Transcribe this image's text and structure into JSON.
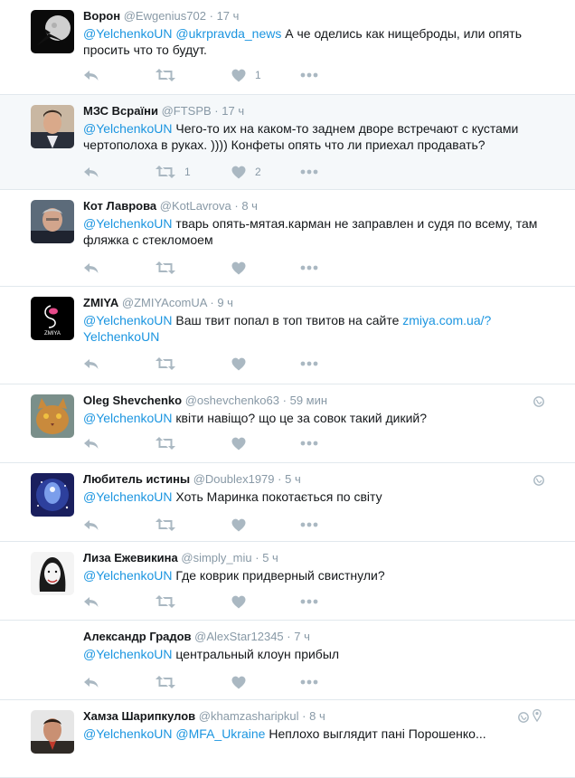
{
  "colors": {
    "link": "#1b95e0",
    "meta": "#8899a6",
    "action_icon": "#aab8c2",
    "highlight_bg": "#f5f8fa",
    "border": "#e1e8ed"
  },
  "tweets": [
    {
      "name": "Ворон",
      "handle": "@Ewgenius702",
      "sep": "·",
      "time": "17 ч",
      "segments": [
        {
          "text": "@YelchenkoUN",
          "link": true
        },
        {
          "text": " ",
          "link": false
        },
        {
          "text": "@ukrpravda_news",
          "link": true
        },
        {
          "text": " А че оделись как нищеброды, или опять просить что то будут.",
          "link": false
        }
      ],
      "retweets": "",
      "likes": "1",
      "avatar": "moon-avatar"
    },
    {
      "name": "МЗС Всраїни",
      "handle": "@FTSPB",
      "sep": "·",
      "time": "17 ч",
      "segments": [
        {
          "text": "@YelchenkoUN",
          "link": true
        },
        {
          "text": " Чего-то их на каком-то заднем дворе встречают с кустами чертополоха в руках. )))) Конфеты опять что ли приехал продавать?",
          "link": false
        }
      ],
      "retweets": "1",
      "likes": "2",
      "avatar": "man-suit-avatar"
    },
    {
      "name": "Кот Лаврова",
      "handle": "@KotLavrova",
      "sep": "·",
      "time": "8 ч",
      "segments": [
        {
          "text": "@YelchenkoUN",
          "link": true
        },
        {
          "text": " тварь опять-мятая.карман не заправлен и судя по всему, там фляжка с стекломоем",
          "link": false
        }
      ],
      "retweets": "",
      "likes": "",
      "avatar": "man-grey-avatar"
    },
    {
      "name": "ZMIYA",
      "handle": "@ZMIYAcomUA",
      "sep": "·",
      "time": "9 ч",
      "segments": [
        {
          "text": "@YelchenkoUN",
          "link": true
        },
        {
          "text": " Ваш твит попал в топ твитов на сайте ",
          "link": false
        },
        {
          "text": "zmiya.com.ua/?YelchenkoUN",
          "link": true
        }
      ],
      "retweets": "",
      "likes": "",
      "avatar": "zmiya-logo-avatar",
      "avatar_text": "ZMIYA"
    },
    {
      "name": "Oleg Shevchenko",
      "handle": "@oshevchenko63",
      "sep": "·",
      "time": "59 мин",
      "segments": [
        {
          "text": "@YelchenkoUN",
          "link": true
        },
        {
          "text": " квіти навіщо? що це за совок такий дикий?",
          "link": false
        }
      ],
      "retweets": "",
      "likes": "",
      "avatar": "cat-avatar",
      "globe": true
    },
    {
      "name": "Любитель истины",
      "handle": "@Doublex1979",
      "sep": "·",
      "time": "5 ч",
      "segments": [
        {
          "text": "@YelchenkoUN",
          "link": true
        },
        {
          "text": " Хоть Маринка покотається по світу",
          "link": false
        }
      ],
      "retweets": "",
      "likes": "",
      "avatar": "cosmic-head-avatar",
      "globe": true
    },
    {
      "name": "Лиза Ежевикина",
      "handle": "@simply_miu",
      "sep": "·",
      "time": "5 ч",
      "segments": [
        {
          "text": "@YelchenkoUN",
          "link": true
        },
        {
          "text": " Где коврик придверный свистнули?",
          "link": false
        }
      ],
      "retweets": "",
      "likes": "",
      "avatar": "woman-sketch-avatar"
    },
    {
      "name": "Александр Градов",
      "handle": "@AlexStar12345",
      "sep": "·",
      "time": "7 ч",
      "segments": [
        {
          "text": "@YelchenkoUN",
          "link": true
        },
        {
          "text": " центральный клоун прибыл",
          "link": false
        }
      ],
      "retweets": "",
      "likes": "",
      "avatar": "none"
    },
    {
      "name": "Хамза Шарипкулов",
      "handle": "@khamzasharipkul",
      "sep": "·",
      "time": "8 ч",
      "segments": [
        {
          "text": "@YelchenkoUN",
          "link": true
        },
        {
          "text": " ",
          "link": false
        },
        {
          "text": "@MFA_Ukraine",
          "link": true
        },
        {
          "text": " Неплохо выглядит пані Порошенко...",
          "link": false
        }
      ],
      "retweets": "",
      "likes": "",
      "avatar": "man-portrait-avatar",
      "globe": true,
      "pin": true
    }
  ]
}
